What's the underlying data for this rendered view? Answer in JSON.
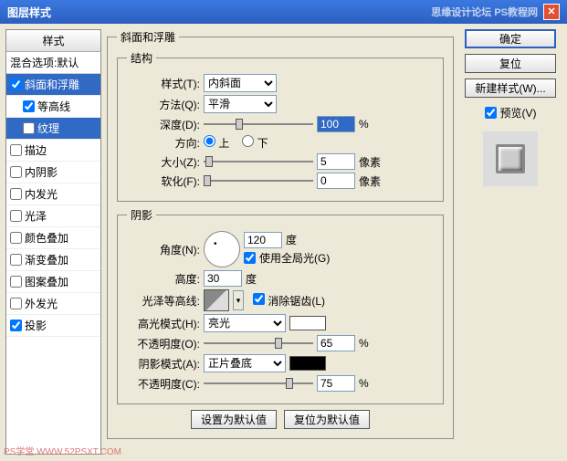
{
  "title": "图层样式",
  "watermark_top": "思缘设计论坛  PS教程网",
  "watermark_bottom": "PS学堂  WWW.52PSXT.COM",
  "styles_panel": {
    "header": "样式",
    "blend_options": "混合选项:默认",
    "items": [
      {
        "label": "斜面和浮雕",
        "checked": true,
        "selected": true,
        "sub": false
      },
      {
        "label": "等高线",
        "checked": true,
        "selected": false,
        "sub": true
      },
      {
        "label": "纹理",
        "checked": false,
        "selected": true,
        "sub": true
      },
      {
        "label": "描边",
        "checked": false,
        "selected": false,
        "sub": false
      },
      {
        "label": "内阴影",
        "checked": false,
        "selected": false,
        "sub": false
      },
      {
        "label": "内发光",
        "checked": false,
        "selected": false,
        "sub": false
      },
      {
        "label": "光泽",
        "checked": false,
        "selected": false,
        "sub": false
      },
      {
        "label": "颜色叠加",
        "checked": false,
        "selected": false,
        "sub": false
      },
      {
        "label": "渐变叠加",
        "checked": false,
        "selected": false,
        "sub": false
      },
      {
        "label": "图案叠加",
        "checked": false,
        "selected": false,
        "sub": false
      },
      {
        "label": "外发光",
        "checked": false,
        "selected": false,
        "sub": false
      },
      {
        "label": "投影",
        "checked": true,
        "selected": false,
        "sub": false
      }
    ]
  },
  "main": {
    "section_title": "斜面和浮雕",
    "structure": {
      "legend": "结构",
      "style_lbl": "样式(T):",
      "style_val": "内斜面",
      "technique_lbl": "方法(Q):",
      "technique_val": "平滑",
      "depth_lbl": "深度(D):",
      "depth_val": "100",
      "depth_unit": "%",
      "direction_lbl": "方向:",
      "up": "上",
      "down": "下",
      "size_lbl": "大小(Z):",
      "size_val": "5",
      "size_unit": "像素",
      "soften_lbl": "软化(F):",
      "soften_val": "0",
      "soften_unit": "像素"
    },
    "shading": {
      "legend": "阴影",
      "angle_lbl": "角度(N):",
      "angle_val": "120",
      "angle_unit": "度",
      "global_light": "使用全局光(G)",
      "altitude_lbl": "高度:",
      "altitude_val": "30",
      "altitude_unit": "度",
      "gloss_contour_lbl": "光泽等高线:",
      "antialias": "消除锯齿(L)",
      "highlight_mode_lbl": "高光模式(H):",
      "highlight_mode_val": "亮光",
      "highlight_opacity_lbl": "不透明度(O):",
      "highlight_opacity_val": "65",
      "opacity_unit": "%",
      "shadow_mode_lbl": "阴影模式(A):",
      "shadow_mode_val": "正片叠底",
      "shadow_opacity_lbl": "不透明度(C):",
      "shadow_opacity_val": "75"
    },
    "buttons": {
      "default": "设置为默认值",
      "reset": "复位为默认值"
    }
  },
  "right": {
    "ok": "确定",
    "cancel": "复位",
    "new_style": "新建样式(W)...",
    "preview": "预览(V)"
  }
}
